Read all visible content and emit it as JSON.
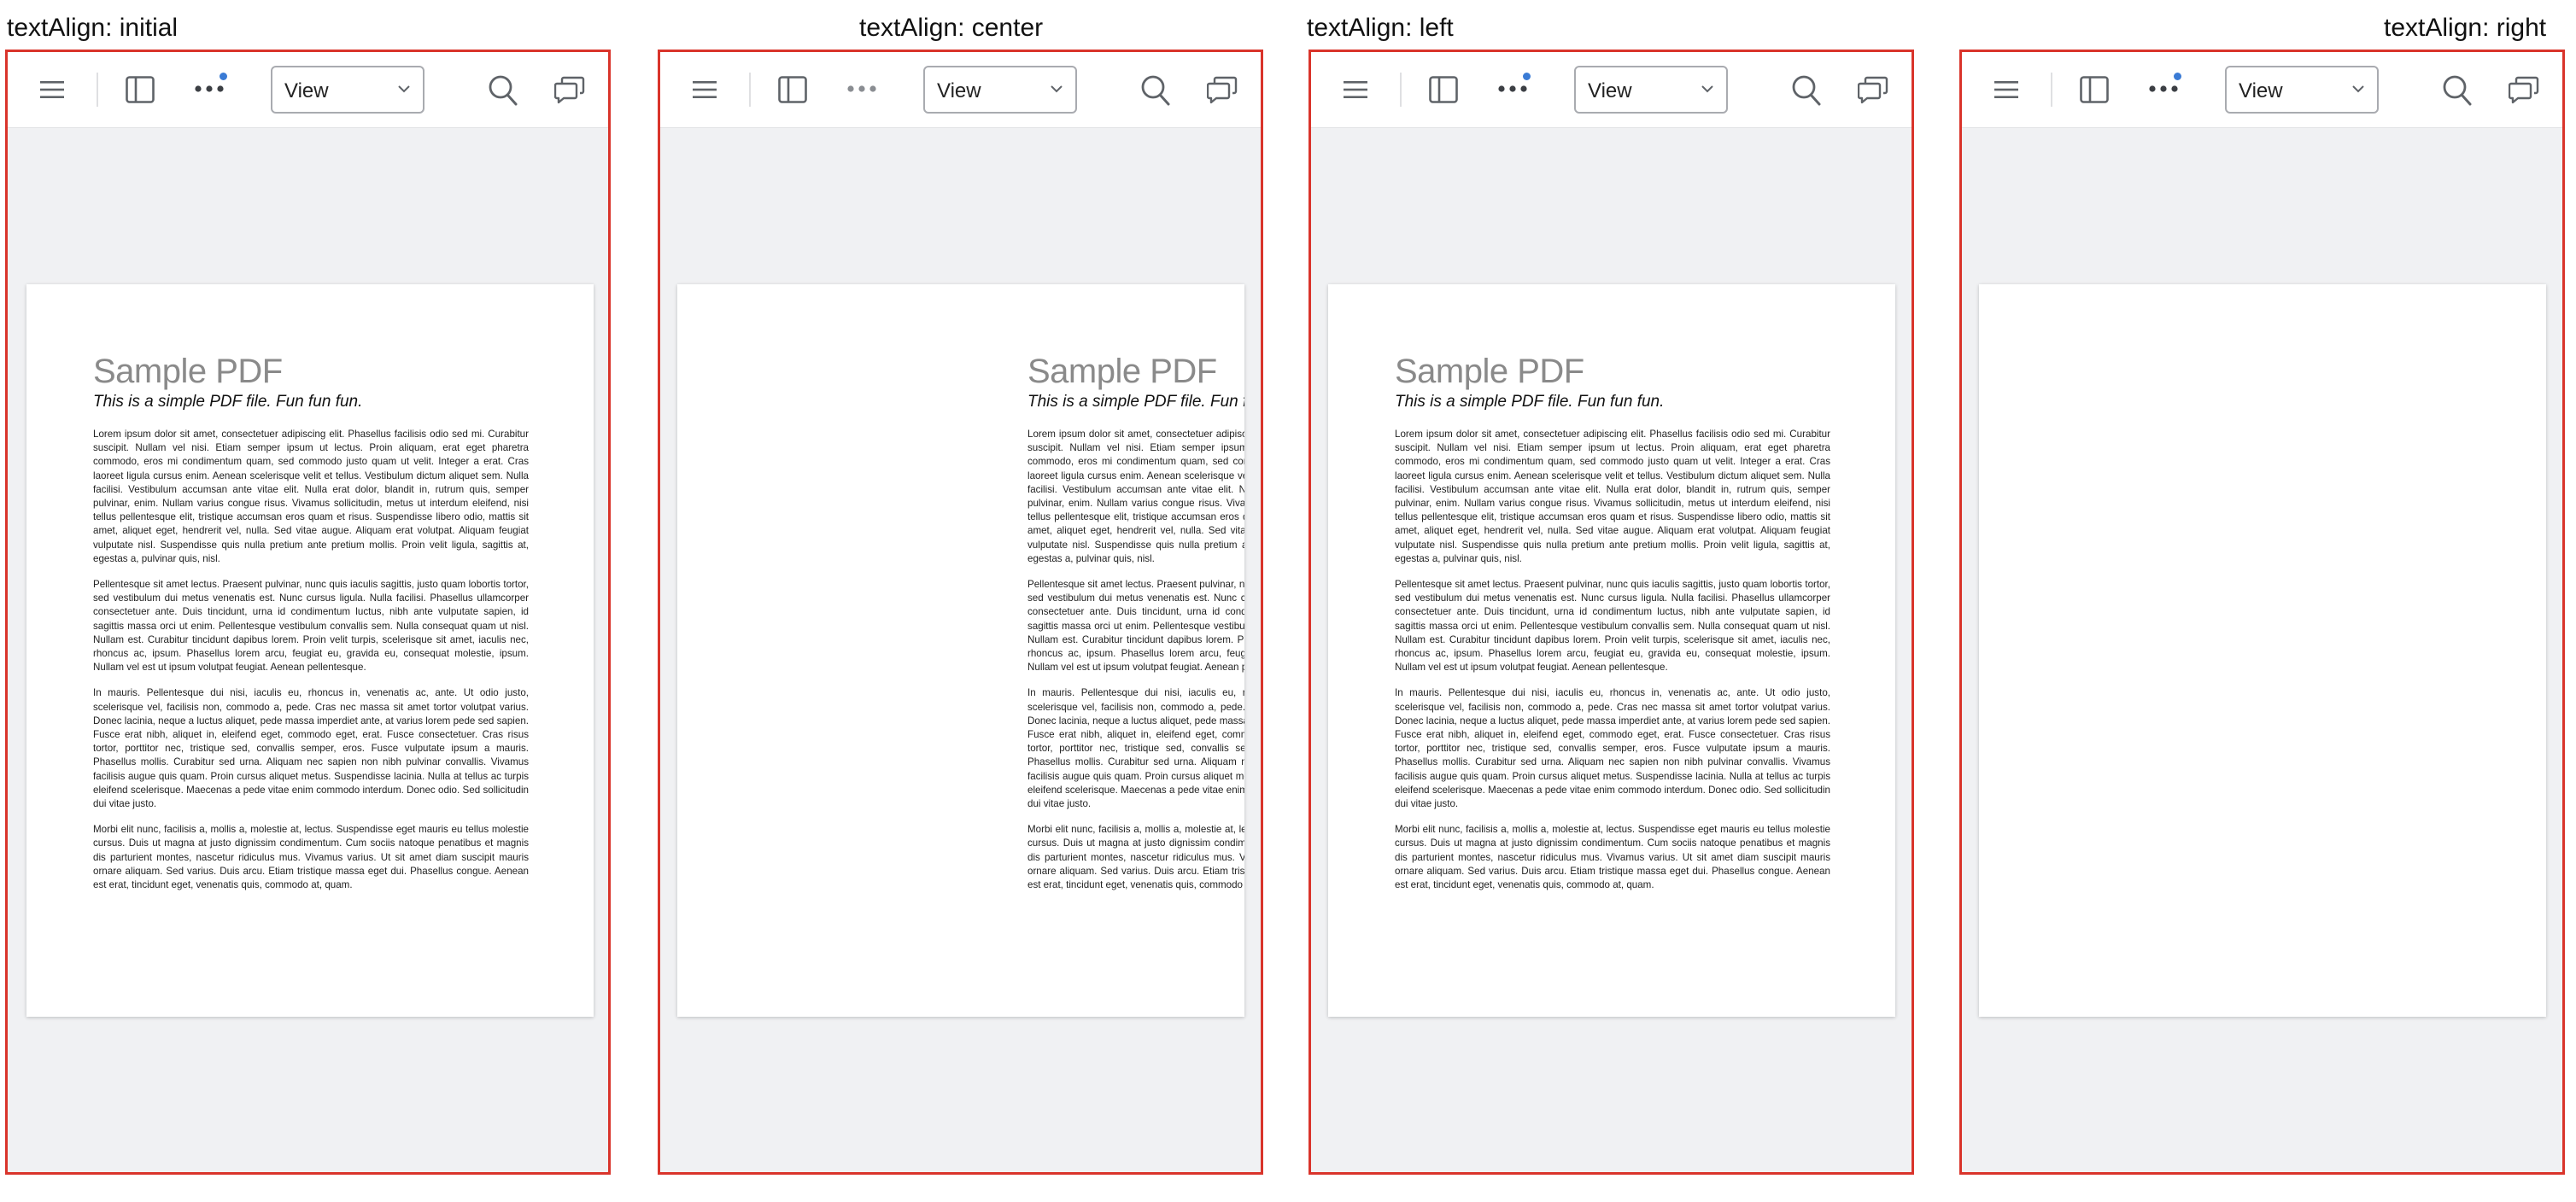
{
  "panels": [
    {
      "caption": "textAlign: initial",
      "dot_badge": true
    },
    {
      "caption": "textAlign: center",
      "dot_badge": false
    },
    {
      "caption": "textAlign: left",
      "dot_badge": true
    },
    {
      "caption": "textAlign: right",
      "dot_badge": true
    }
  ],
  "toolbar": {
    "view_select_value": "View",
    "icons": {
      "menu": "hamburger-icon",
      "sidebar": "sidebar-toggle-icon",
      "more": "more-options-icon",
      "search": "search-icon",
      "comments": "comments-icon"
    }
  },
  "document": {
    "title": "Sample PDF",
    "subtitle": "This is a simple PDF file. Fun fun fun.",
    "paragraphs": [
      "Lorem ipsum dolor sit amet, consectetuer adipiscing elit. Phasellus facilisis odio sed mi. Curabitur suscipit. Nullam vel nisi. Etiam semper ipsum ut lectus. Proin aliquam, erat eget pharetra commodo, eros mi condimentum quam, sed commodo justo quam ut velit. Integer a erat. Cras laoreet ligula cursus enim. Aenean scelerisque velit et tellus. Vestibulum dictum aliquet sem. Nulla facilisi. Vestibulum accumsan ante vitae elit. Nulla erat dolor, blandit in, rutrum quis, semper pulvinar, enim. Nullam varius congue risus. Vivamus sollicitudin, metus ut interdum eleifend, nisi tellus pellentesque elit, tristique accumsan eros quam et risus. Suspendisse libero odio, mattis sit amet, aliquet eget, hendrerit vel, nulla. Sed vitae augue. Aliquam erat volutpat. Aliquam feugiat vulputate nisl. Suspendisse quis nulla pretium ante pretium mollis. Proin velit ligula, sagittis at, egestas a, pulvinar quis, nisl.",
      "Pellentesque sit amet lectus. Praesent pulvinar, nunc quis iaculis sagittis, justo quam lobortis tortor, sed vestibulum dui metus venenatis est. Nunc cursus ligula. Nulla facilisi. Phasellus ullamcorper consectetuer ante. Duis tincidunt, urna id condimentum luctus, nibh ante vulputate sapien, id sagittis massa orci ut enim. Pellentesque vestibulum convallis sem. Nulla consequat quam ut nisl. Nullam est. Curabitur tincidunt dapibus lorem. Proin velit turpis, scelerisque sit amet, iaculis nec, rhoncus ac, ipsum. Phasellus lorem arcu, feugiat eu, gravida eu, consequat molestie, ipsum. Nullam vel est ut ipsum volutpat feugiat. Aenean pellentesque.",
      "In mauris. Pellentesque dui nisi, iaculis eu, rhoncus in, venenatis ac, ante. Ut odio justo, scelerisque vel, facilisis non, commodo a, pede. Cras nec massa sit amet tortor volutpat varius. Donec lacinia, neque a luctus aliquet, pede massa imperdiet ante, at varius lorem pede sed sapien. Fusce erat nibh, aliquet in, eleifend eget, commodo eget, erat. Fusce consectetuer. Cras risus tortor, porttitor nec, tristique sed, convallis semper, eros. Fusce vulputate ipsum a mauris. Phasellus mollis. Curabitur sed urna. Aliquam nec sapien non nibh pulvinar convallis. Vivamus facilisis augue quis quam. Proin cursus aliquet metus. Suspendisse lacinia. Nulla at tellus ac turpis eleifend scelerisque. Maecenas a pede vitae enim commodo interdum. Donec odio. Sed sollicitudin dui vitae justo.",
      "Morbi elit nunc, facilisis a, mollis a, molestie at, lectus. Suspendisse eget mauris eu tellus molestie cursus. Duis ut magna at justo dignissim condimentum. Cum sociis natoque penatibus et magnis dis parturient montes, nascetur ridiculus mus. Vivamus varius. Ut sit amet diam suscipit mauris ornare aliquam. Sed varius. Duis arcu. Etiam tristique massa eget dui. Phasellus congue. Aenean est erat, tincidunt eget, venenatis quis, commodo at, quam."
    ]
  }
}
